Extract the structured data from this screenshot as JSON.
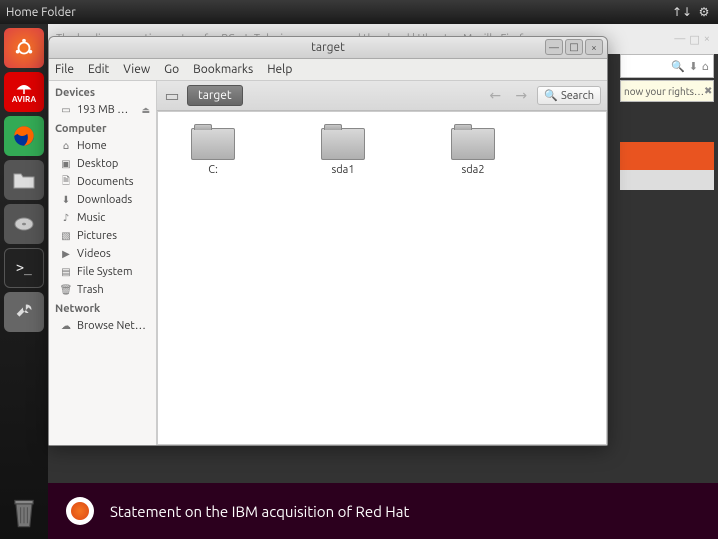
{
  "top_panel": {
    "title": "Home Folder"
  },
  "launcher": {
    "items": [
      "ubuntu",
      "avira",
      "firefox",
      "files",
      "disk",
      "terminal",
      "settings"
    ],
    "avira_text": "AVIRA"
  },
  "bg_firefox": {
    "title": "The leading operating system for PCs, IoT devices, servers and the cloud | Ubuntu - Mozilla Firefox",
    "rights": "now your rights…"
  },
  "nautilus": {
    "title": "target",
    "menus": {
      "file": "File",
      "edit": "Edit",
      "view": "View",
      "go": "Go",
      "bookmarks": "Bookmarks",
      "help": "Help"
    },
    "sidebar": {
      "devices_head": "Devices",
      "device": "193 MB …",
      "computer_head": "Computer",
      "places": {
        "home": "Home",
        "desktop": "Desktop",
        "documents": "Documents",
        "downloads": "Downloads",
        "music": "Music",
        "pictures": "Pictures",
        "videos": "Videos",
        "filesystem": "File System",
        "trash": "Trash"
      },
      "network_head": "Network",
      "browse_net": "Browse Net…"
    },
    "location": {
      "path_button": "target",
      "search_label": "Search"
    },
    "folders": [
      {
        "name": "C:"
      },
      {
        "name": "sda1"
      },
      {
        "name": "sda2"
      }
    ]
  },
  "banner": {
    "text": "Statement on the IBM acquisition of Red Hat"
  }
}
